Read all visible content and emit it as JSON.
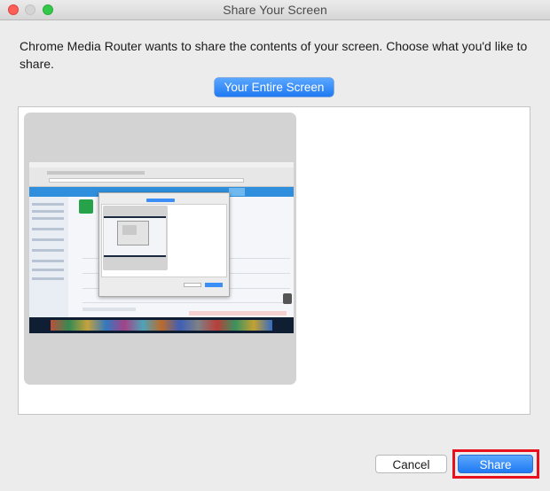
{
  "window": {
    "title": "Share Your Screen"
  },
  "dialog": {
    "message": "Chrome Media Router wants to share the contents of your screen. Choose what you'd like to share.",
    "source_tab_label": "Your Entire Screen",
    "cancel_label": "Cancel",
    "share_label": "Share"
  },
  "colors": {
    "accent": "#1f79f2",
    "highlight": "#e8101c"
  }
}
